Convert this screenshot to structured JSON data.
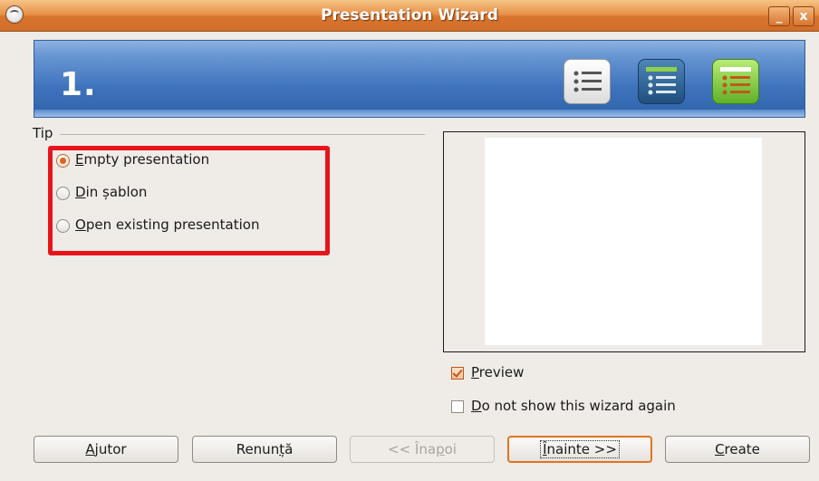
{
  "window": {
    "title": "Presentation Wizard",
    "minimize_glyph": "_",
    "close_glyph": "x",
    "menu_icon": "window-menu-icon"
  },
  "banner": {
    "step": "1.",
    "icons": [
      "list-page-icon",
      "dark-list-page-icon",
      "green-list-page-icon"
    ]
  },
  "type_group": {
    "label": "Tip",
    "options": [
      {
        "mnemonic": "E",
        "rest": "mpty presentation",
        "selected": true
      },
      {
        "mnemonic": "D",
        "rest": "in șablon",
        "selected": false
      },
      {
        "mnemonic": "O",
        "rest": "pen existing presentation",
        "selected": false
      }
    ]
  },
  "preview": {
    "label_mnemonic": "P",
    "label_rest": "review",
    "checked": true
  },
  "dont_show": {
    "label_mnemonic": "D",
    "label_rest": "o not show this wizard again",
    "checked": false
  },
  "buttons": {
    "help": {
      "mnemonic": "A",
      "rest": "jutor"
    },
    "cancel": {
      "pre": "Renun",
      "mnemonic": "ț",
      "rest": "ă"
    },
    "back": {
      "pre": "<< Îna",
      "mnemonic": "p",
      "rest": "oi",
      "enabled": false
    },
    "next": {
      "mnemonic": "Î",
      "rest": "nainte >>"
    },
    "create": {
      "mnemonic": "C",
      "rest": "reate"
    }
  },
  "colors": {
    "titlebar": "#d9752d",
    "highlight_box": "#e8141c",
    "accent": "#e0641d"
  }
}
